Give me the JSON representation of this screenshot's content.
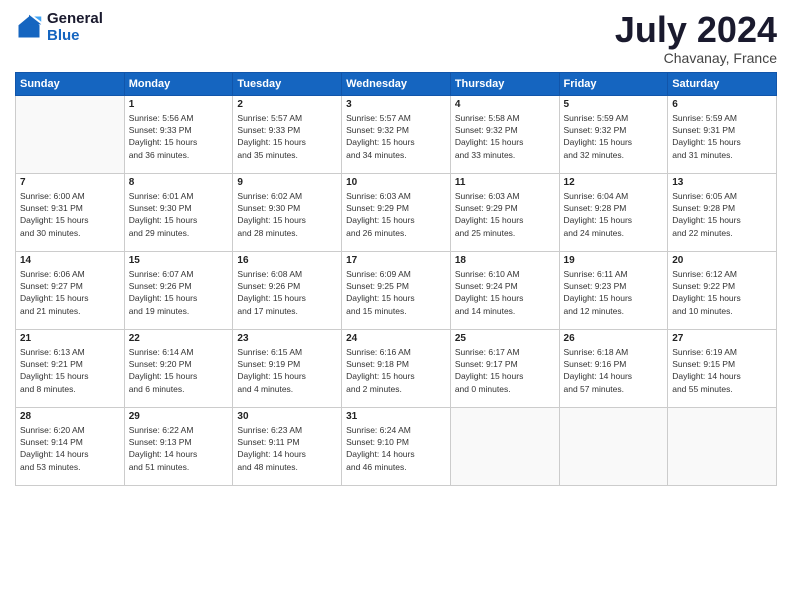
{
  "header": {
    "logo_line1": "General",
    "logo_line2": "Blue",
    "month": "July 2024",
    "location": "Chavanay, France"
  },
  "days_of_week": [
    "Sunday",
    "Monday",
    "Tuesday",
    "Wednesday",
    "Thursday",
    "Friday",
    "Saturday"
  ],
  "weeks": [
    [
      {
        "day": "",
        "info": ""
      },
      {
        "day": "1",
        "info": "Sunrise: 5:56 AM\nSunset: 9:33 PM\nDaylight: 15 hours\nand 36 minutes."
      },
      {
        "day": "2",
        "info": "Sunrise: 5:57 AM\nSunset: 9:33 PM\nDaylight: 15 hours\nand 35 minutes."
      },
      {
        "day": "3",
        "info": "Sunrise: 5:57 AM\nSunset: 9:32 PM\nDaylight: 15 hours\nand 34 minutes."
      },
      {
        "day": "4",
        "info": "Sunrise: 5:58 AM\nSunset: 9:32 PM\nDaylight: 15 hours\nand 33 minutes."
      },
      {
        "day": "5",
        "info": "Sunrise: 5:59 AM\nSunset: 9:32 PM\nDaylight: 15 hours\nand 32 minutes."
      },
      {
        "day": "6",
        "info": "Sunrise: 5:59 AM\nSunset: 9:31 PM\nDaylight: 15 hours\nand 31 minutes."
      }
    ],
    [
      {
        "day": "7",
        "info": "Sunrise: 6:00 AM\nSunset: 9:31 PM\nDaylight: 15 hours\nand 30 minutes."
      },
      {
        "day": "8",
        "info": "Sunrise: 6:01 AM\nSunset: 9:30 PM\nDaylight: 15 hours\nand 29 minutes."
      },
      {
        "day": "9",
        "info": "Sunrise: 6:02 AM\nSunset: 9:30 PM\nDaylight: 15 hours\nand 28 minutes."
      },
      {
        "day": "10",
        "info": "Sunrise: 6:03 AM\nSunset: 9:29 PM\nDaylight: 15 hours\nand 26 minutes."
      },
      {
        "day": "11",
        "info": "Sunrise: 6:03 AM\nSunset: 9:29 PM\nDaylight: 15 hours\nand 25 minutes."
      },
      {
        "day": "12",
        "info": "Sunrise: 6:04 AM\nSunset: 9:28 PM\nDaylight: 15 hours\nand 24 minutes."
      },
      {
        "day": "13",
        "info": "Sunrise: 6:05 AM\nSunset: 9:28 PM\nDaylight: 15 hours\nand 22 minutes."
      }
    ],
    [
      {
        "day": "14",
        "info": "Sunrise: 6:06 AM\nSunset: 9:27 PM\nDaylight: 15 hours\nand 21 minutes."
      },
      {
        "day": "15",
        "info": "Sunrise: 6:07 AM\nSunset: 9:26 PM\nDaylight: 15 hours\nand 19 minutes."
      },
      {
        "day": "16",
        "info": "Sunrise: 6:08 AM\nSunset: 9:26 PM\nDaylight: 15 hours\nand 17 minutes."
      },
      {
        "day": "17",
        "info": "Sunrise: 6:09 AM\nSunset: 9:25 PM\nDaylight: 15 hours\nand 15 minutes."
      },
      {
        "day": "18",
        "info": "Sunrise: 6:10 AM\nSunset: 9:24 PM\nDaylight: 15 hours\nand 14 minutes."
      },
      {
        "day": "19",
        "info": "Sunrise: 6:11 AM\nSunset: 9:23 PM\nDaylight: 15 hours\nand 12 minutes."
      },
      {
        "day": "20",
        "info": "Sunrise: 6:12 AM\nSunset: 9:22 PM\nDaylight: 15 hours\nand 10 minutes."
      }
    ],
    [
      {
        "day": "21",
        "info": "Sunrise: 6:13 AM\nSunset: 9:21 PM\nDaylight: 15 hours\nand 8 minutes."
      },
      {
        "day": "22",
        "info": "Sunrise: 6:14 AM\nSunset: 9:20 PM\nDaylight: 15 hours\nand 6 minutes."
      },
      {
        "day": "23",
        "info": "Sunrise: 6:15 AM\nSunset: 9:19 PM\nDaylight: 15 hours\nand 4 minutes."
      },
      {
        "day": "24",
        "info": "Sunrise: 6:16 AM\nSunset: 9:18 PM\nDaylight: 15 hours\nand 2 minutes."
      },
      {
        "day": "25",
        "info": "Sunrise: 6:17 AM\nSunset: 9:17 PM\nDaylight: 15 hours\nand 0 minutes."
      },
      {
        "day": "26",
        "info": "Sunrise: 6:18 AM\nSunset: 9:16 PM\nDaylight: 14 hours\nand 57 minutes."
      },
      {
        "day": "27",
        "info": "Sunrise: 6:19 AM\nSunset: 9:15 PM\nDaylight: 14 hours\nand 55 minutes."
      }
    ],
    [
      {
        "day": "28",
        "info": "Sunrise: 6:20 AM\nSunset: 9:14 PM\nDaylight: 14 hours\nand 53 minutes."
      },
      {
        "day": "29",
        "info": "Sunrise: 6:22 AM\nSunset: 9:13 PM\nDaylight: 14 hours\nand 51 minutes."
      },
      {
        "day": "30",
        "info": "Sunrise: 6:23 AM\nSunset: 9:11 PM\nDaylight: 14 hours\nand 48 minutes."
      },
      {
        "day": "31",
        "info": "Sunrise: 6:24 AM\nSunset: 9:10 PM\nDaylight: 14 hours\nand 46 minutes."
      },
      {
        "day": "",
        "info": ""
      },
      {
        "day": "",
        "info": ""
      },
      {
        "day": "",
        "info": ""
      }
    ]
  ]
}
